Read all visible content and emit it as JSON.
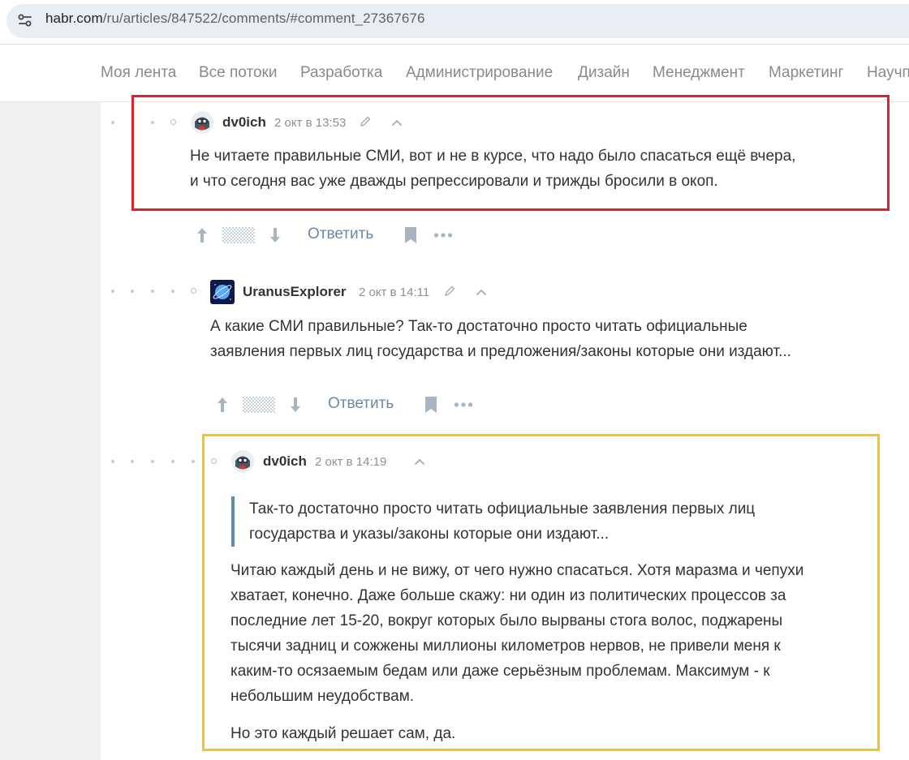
{
  "browser": {
    "url_host": "habr.com",
    "url_path": "/ru/articles/847522/comments/#comment_27367676"
  },
  "nav": {
    "items": [
      "Моя лента",
      "Все потоки",
      "Разработка",
      "Администрирование",
      "Дизайн",
      "Менеджмент",
      "Маркетинг",
      "Научп"
    ]
  },
  "comments": [
    {
      "author": "dv0ich",
      "time": "2 окт в 13:53",
      "edited": true,
      "lines": [
        "Не читаете правильные СМИ, вот и не в курсе, что надо было спасаться ещё вчера,",
        "и что сегодня вас уже дважды репрессировали и трижды бросили в окоп."
      ],
      "reply_label": "Ответить"
    },
    {
      "author": "UranusExplorer",
      "time": "2 окт в 14:11",
      "edited": true,
      "lines": [
        "А какие СМИ правильные? Так-то достаточно просто читать официальные",
        "заявления первых лиц государства и предложения/законы которые они издают..."
      ],
      "reply_label": "Ответить"
    },
    {
      "author": "dv0ich",
      "time": "2 окт в 14:19",
      "edited": false,
      "quote_lines": [
        "Так-то достаточно просто читать официальные заявления первых лиц",
        "государства и указы/законы которые они издают..."
      ],
      "paragraph_lines": [
        "Читаю каждый день и не вижу, от чего нужно спасаться. Хотя маразма и чепухи",
        "хватает, конечно. Даже больше скажу: ни один из политических процессов за",
        "последние лет 15-20, вокруг которых было вырваны стога волос, поджарены",
        "тысячи задниц и сожжены миллионы километров нервов, не привели меня к",
        "каким-то осязаемым бедам или даже серьёзным проблемам. Максимум - к",
        "небольшим неудобствам."
      ],
      "last_line": "Но это каждый решает сам, да."
    }
  ],
  "icons": {
    "tune": "tune-icon",
    "pen": "pencil-icon",
    "caret": "chevron-up-icon",
    "upvote": "arrow-up-icon",
    "downvote": "arrow-down-icon",
    "bookmark": "bookmark-icon",
    "more": "more-icon"
  },
  "colors": {
    "highlight_red": "#e0202a",
    "highlight_yellow": "#f5c518",
    "link": "#6b8aa6",
    "quote_bar": "#5e8da8"
  }
}
